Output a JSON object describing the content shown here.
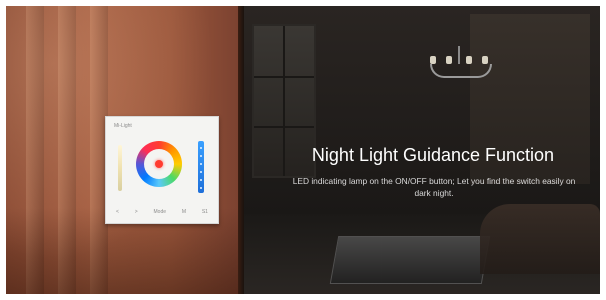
{
  "headline": {
    "title": "Night Light Guidance Function",
    "description": "LED indicating lamp on the ON/OFF button; Let you find the switch easily on dark night."
  },
  "panel": {
    "brand": "Mi-Light",
    "buttons": [
      "<",
      ">",
      "Mode",
      "M",
      "S1"
    ]
  },
  "colors": {
    "wall": "#a25c40",
    "room_dark": "#1e1b19",
    "indicator_led": "#ff3b30",
    "slider_blue": "#1e6fd9"
  },
  "icons": [
    "chandelier-icon",
    "color-ring-icon",
    "brightness-bar-icon",
    "zone-slider-icon"
  ]
}
